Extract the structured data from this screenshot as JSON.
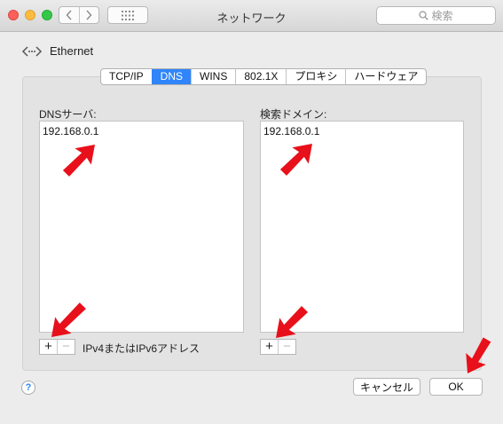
{
  "window": {
    "title": "ネットワーク"
  },
  "toolbar": {
    "search_placeholder": "検索"
  },
  "header": {
    "interface_name": "Ethernet"
  },
  "tabs": [
    {
      "label": "TCP/IP",
      "active": false
    },
    {
      "label": "DNS",
      "active": true
    },
    {
      "label": "WINS",
      "active": false
    },
    {
      "label": "802.1X",
      "active": false
    },
    {
      "label": "プロキシ",
      "active": false
    },
    {
      "label": "ハードウェア",
      "active": false
    }
  ],
  "dns_servers": {
    "label": "DNSサーバ:",
    "entries": [
      "192.168.0.1"
    ],
    "hint": "IPv4またはIPv6アドレス"
  },
  "search_domains": {
    "label": "検索ドメイン:",
    "entries": [
      "192.168.0.1"
    ]
  },
  "controls": {
    "add_symbol": "+",
    "remove_symbol": "−"
  },
  "footer": {
    "help_symbol": "?",
    "cancel_label": "キャンセル",
    "ok_label": "OK"
  },
  "colors": {
    "accent": "#2f85f9",
    "annotation_arrow": "#e8101a"
  }
}
